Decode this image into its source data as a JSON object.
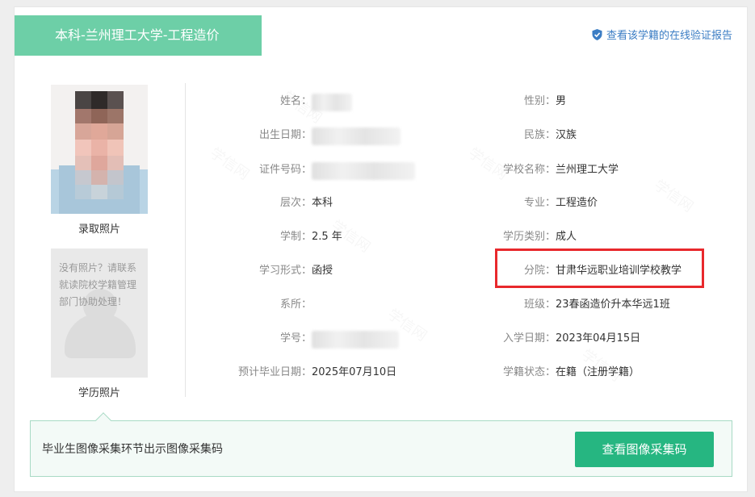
{
  "header": {
    "title": "本科-兰州理工大学-工程造价",
    "verify_link": "查看该学籍的在线验证报告",
    "verify_icon": "shield-check-icon"
  },
  "photos": {
    "admission_caption": "录取照片",
    "degree_caption": "学历照片",
    "degree_missing_message": "没有照片？请联系就读院校学籍管理部门协助处理！"
  },
  "fields_left": [
    {
      "label": "姓名：",
      "value": ""
    },
    {
      "label": "出生日期：",
      "value": ""
    },
    {
      "label": "证件号码：",
      "value": ""
    },
    {
      "label": "层次：",
      "value": "本科"
    },
    {
      "label": "学制：",
      "value": "2.5 年"
    },
    {
      "label": "学习形式：",
      "value": "函授"
    },
    {
      "label": "系所：",
      "value": ""
    },
    {
      "label": "学号：",
      "value": ""
    },
    {
      "label": "预计毕业日期：",
      "value": "2025年07月10日"
    }
  ],
  "fields_right": [
    {
      "label": "性别：",
      "value": "男"
    },
    {
      "label": "民族：",
      "value": "汉族"
    },
    {
      "label": "学校名称：",
      "value": "兰州理工大学"
    },
    {
      "label": "专业：",
      "value": "工程造价"
    },
    {
      "label": "学历类别：",
      "value": "成人"
    },
    {
      "label": "分院：",
      "value": "甘肃华远职业培训学校教学"
    },
    {
      "label": "班级：",
      "value": "23春函造价升本华远1班"
    },
    {
      "label": "入学日期：",
      "value": "2023年04月15日"
    },
    {
      "label": "学籍状态：",
      "value": "在籍（注册学籍）"
    }
  ],
  "notice": {
    "text": "毕业生图像采集环节出示图像采集码",
    "button_label": "查看图像采集码"
  },
  "watermark_text": "学信网",
  "colors": {
    "title_bg": "#6dcfa7",
    "button_bg": "#26b681",
    "link": "#3b7dc4",
    "highlight": "#e8282c"
  }
}
